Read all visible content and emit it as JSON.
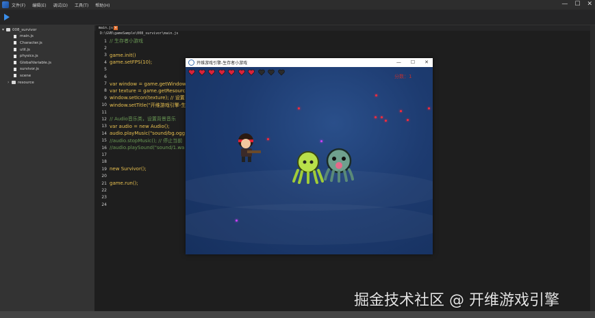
{
  "menubar": {
    "items": [
      "文件(F)",
      "编辑(E)",
      "调试(D)",
      "工具(T)",
      "帮助(H)"
    ]
  },
  "window_controls": [
    "—",
    "☐",
    "✕"
  ],
  "sidebar": {
    "root": "008_survivor",
    "items": [
      "main.js",
      "Character.js",
      "util.js",
      "physics.js",
      "GlobalVariable.js",
      "survivor.js",
      "scene",
      "resource"
    ]
  },
  "editor": {
    "tab": "main.js",
    "path": "D:\\GVB\\gameSample\\008_survivor\\main.js",
    "lines": [
      "// 生存者小游戏",
      "",
      "game.init()",
      "game.setFPS(10);",
      "",
      "",
      "var window = game.getWindow",
      "var texture = game.getResource",
      "window.setIcon(texture); // 设置",
      "window.setTitle(\"开维游戏引擎-生",
      "",
      "// Audio音乐类，设置背景音乐",
      "var audio = new Audio();",
      "audio.playMusic(\"sound/bg.ogg",
      "//audio.stopMusic(); // 停止当前",
      "//audio.playSound(\"sound/1.wa",
      "",
      "",
      "new Survivor();",
      "",
      "game.run();",
      "",
      "",
      ""
    ]
  },
  "game_window": {
    "title": "开维游戏引擎-生存者小游戏",
    "controls": [
      "—",
      "☐",
      "✕"
    ],
    "hearts": {
      "filled": 7,
      "total": 10
    },
    "score": "分数：1",
    "colors": {
      "heart": "#d9223a",
      "heart_empty": "#2b2b2b",
      "bullet": "#ff2a3a",
      "orb": "#d040ff"
    }
  },
  "watermark": "掘金技术社区 @ 开维游戏引擎"
}
